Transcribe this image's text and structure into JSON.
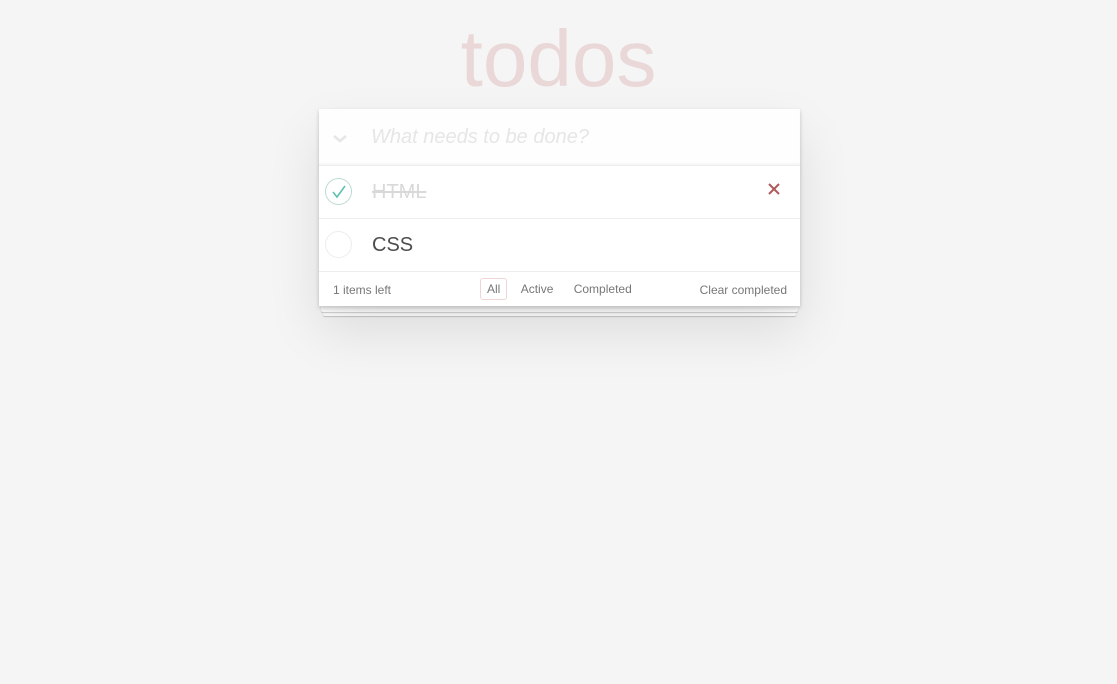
{
  "app": {
    "title": "todos"
  },
  "new_todo": {
    "placeholder": "What needs to be done?",
    "value": ""
  },
  "todos": [
    {
      "label": "HTML",
      "completed": true
    },
    {
      "label": "CSS",
      "completed": false
    }
  ],
  "footer": {
    "count_text": "1 items left",
    "filters": [
      {
        "label": "All",
        "selected": true
      },
      {
        "label": "Active",
        "selected": false
      },
      {
        "label": "Completed",
        "selected": false
      }
    ],
    "clear_completed": "Clear completed"
  },
  "colors": {
    "background": "#f5f5f5",
    "title": "rgba(175, 47, 47, 0.15)",
    "check": "#5dc2af",
    "destroy": "#af5b5e",
    "completed_text": "#d9d9d9"
  },
  "icons": {
    "toggle_all": "chevron-down-icon",
    "check": "check-icon",
    "destroy": "close-icon"
  }
}
